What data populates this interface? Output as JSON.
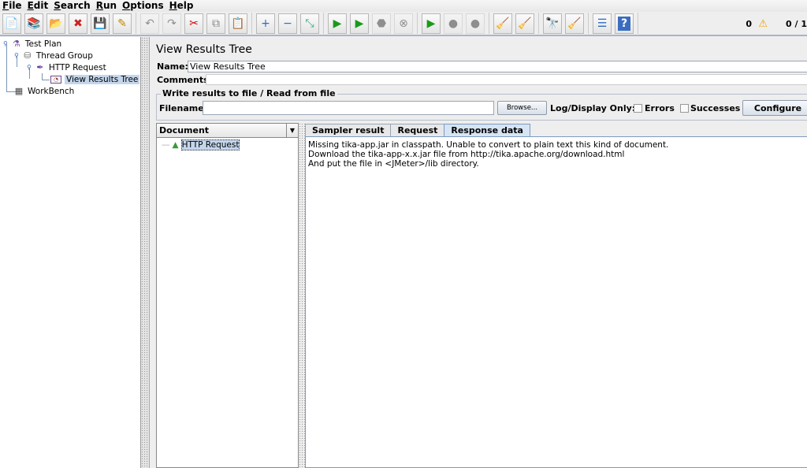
{
  "menu": [
    {
      "mn": "F",
      "rest": "ile"
    },
    {
      "mn": "E",
      "rest": "dit"
    },
    {
      "mn": "S",
      "rest": "earch"
    },
    {
      "mn": "R",
      "rest": "un"
    },
    {
      "mn": "O",
      "rest": "ptions"
    },
    {
      "mn": "H",
      "rest": "elp"
    }
  ],
  "toolbar": {
    "groups": [
      [
        {
          "name": "new",
          "icon": "📄",
          "color": "#888"
        },
        {
          "name": "templates",
          "icon": "📚",
          "color": "#2a8"
        },
        {
          "name": "open",
          "icon": "📂",
          "color": "#d90"
        },
        {
          "name": "close",
          "icon": "✖",
          "color": "#c22"
        },
        {
          "name": "save",
          "icon": "💾",
          "color": "#333"
        },
        {
          "name": "save-as",
          "icon": "✎",
          "color": "#b80"
        }
      ],
      [
        {
          "name": "undo",
          "icon": "↶",
          "disabled": true
        },
        {
          "name": "redo",
          "icon": "↷",
          "disabled": true
        },
        {
          "name": "cut",
          "icon": "✂",
          "color": "#c00"
        },
        {
          "name": "copy",
          "icon": "⧉",
          "color": "#888"
        },
        {
          "name": "paste",
          "icon": "📋",
          "color": "#963"
        }
      ],
      [
        {
          "name": "expand-all",
          "icon": "+",
          "color": "#2a6cc0"
        },
        {
          "name": "collapse-all",
          "icon": "−",
          "color": "#2a6cc0"
        },
        {
          "name": "toggle",
          "icon": "⤡",
          "color": "#3a8"
        }
      ],
      [
        {
          "name": "start",
          "icon": "▶",
          "color": "#1a9a1a"
        },
        {
          "name": "start-no-pauses",
          "icon": "▶",
          "color": "#1a9a1a"
        },
        {
          "name": "stop",
          "icon": "⬣",
          "disabled": true
        },
        {
          "name": "shutdown",
          "icon": "⊗",
          "disabled": true
        }
      ],
      [
        {
          "name": "remote-start-all",
          "icon": "▶",
          "color": "#1a9a1a"
        },
        {
          "name": "remote-stop-all",
          "icon": "●",
          "disabled": true
        },
        {
          "name": "remote-shutdown-all",
          "icon": "●",
          "disabled": true
        }
      ],
      [
        {
          "name": "clear",
          "icon": "🧹",
          "color": "#a74"
        },
        {
          "name": "clear-all",
          "icon": "🧹",
          "color": "#a74"
        }
      ],
      [
        {
          "name": "search",
          "icon": "🔭",
          "color": "#222"
        },
        {
          "name": "reset-search",
          "icon": "🧹",
          "color": "#db0"
        }
      ],
      [
        {
          "name": "function-helper",
          "icon": "☰",
          "color": "#2a6cc0"
        },
        {
          "name": "help",
          "icon": "?",
          "color": "#fff",
          "bg": "#3a6cc0"
        }
      ]
    ]
  },
  "status": {
    "errors": "0",
    "threads": "0 / 1"
  },
  "tree": {
    "test_plan": "Test Plan",
    "thread_group": "Thread Group",
    "http_request": "HTTP Request",
    "view_results_tree": "View Results Tree",
    "workbench": "WorkBench"
  },
  "panel": {
    "title": "View Results Tree",
    "name_label": "Name:",
    "name_value": "View Results Tree",
    "comments_label": "Comments:",
    "file_legend": "Write results to file / Read from file",
    "filename_label": "Filename",
    "filename_value": "",
    "browse": "Browse...",
    "log_display": "Log/Display Only:",
    "errors": "Errors",
    "errors_checked": false,
    "successes": "Successes",
    "successes_checked": false,
    "configure": "Configure"
  },
  "results": {
    "renderer": "Document",
    "items": [
      "HTTP Request"
    ],
    "tabs": [
      "Sampler result",
      "Request",
      "Response data"
    ],
    "active_tab": "Response data",
    "response_lines": [
      "Missing tika-app.jar in classpath. Unable to convert to plain text this kind of document.",
      "Download the tika-app-x.x.jar file from http://tika.apache.org/download.html",
      "And put the file in <JMeter>/lib directory."
    ]
  }
}
